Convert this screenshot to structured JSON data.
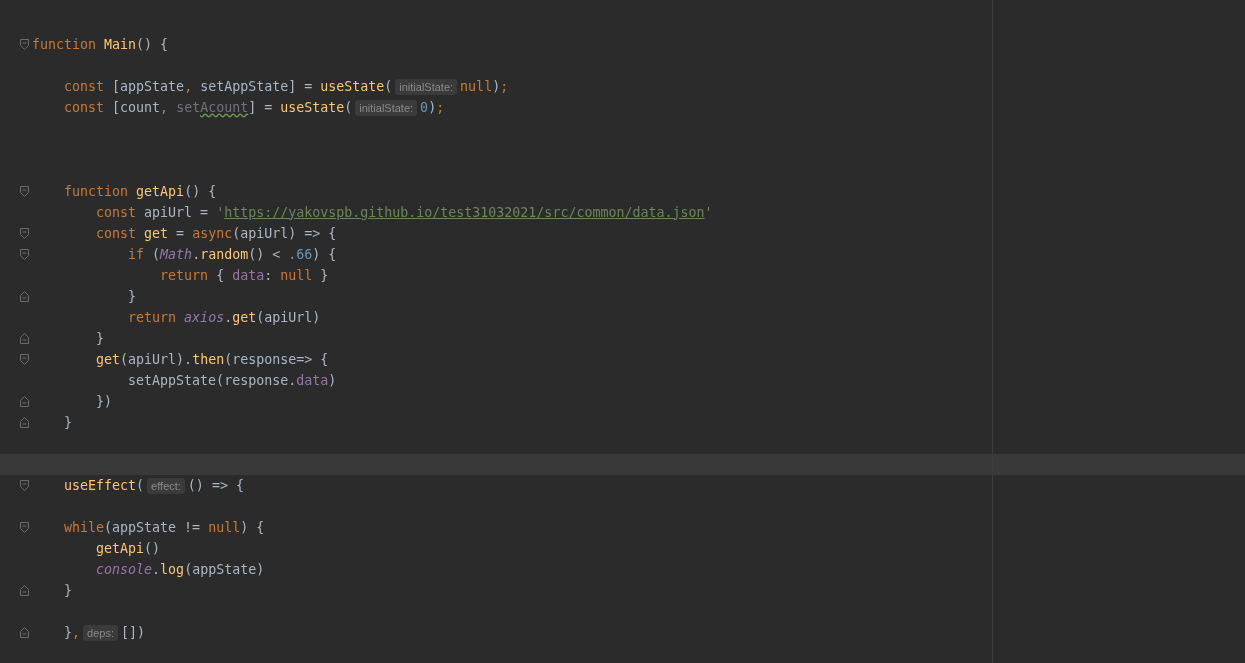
{
  "editor": {
    "lines": [
      {
        "kind": "fold_start",
        "tokens": [
          {
            "t": "function ",
            "kind": "kw"
          },
          {
            "t": "Main",
            "kind": "fn"
          },
          {
            "t": "() {",
            "kind": "p"
          }
        ]
      },
      {
        "kind": "plain"
      },
      {
        "kind": "plain",
        "tokens": [
          {
            "t": "    const",
            "kind": "kw"
          },
          {
            "t": " [appState",
            "kind": "p"
          },
          {
            "t": ",",
            "kind": "kw"
          },
          {
            "t": " setAppState] = ",
            "kind": "p"
          },
          {
            "t": "useState",
            "kind": "fn"
          },
          {
            "t": "(",
            "kind": "p"
          },
          {
            "t": "initialState:",
            "kind": "hint"
          },
          {
            "t": "null",
            "kind": "kw"
          },
          {
            "t": ")",
            "kind": "p"
          },
          {
            "t": ";",
            "kind": "kw"
          }
        ]
      },
      {
        "kind": "plain",
        "tokens": [
          {
            "t": "    const",
            "kind": "kw"
          },
          {
            "t": " [count",
            "kind": "p"
          },
          {
            "t": ",",
            "kind": "kw"
          },
          {
            "t": " set",
            "kind": "unused"
          },
          {
            "t": "Acount",
            "kind": "typo"
          },
          {
            "t": "] = ",
            "kind": "p"
          },
          {
            "t": "useState",
            "kind": "fn"
          },
          {
            "t": "(",
            "kind": "p"
          },
          {
            "t": "initialState:",
            "kind": "hint"
          },
          {
            "t": "0",
            "kind": "num"
          },
          {
            "t": ")",
            "kind": "p"
          },
          {
            "t": ";",
            "kind": "kw"
          }
        ]
      },
      {
        "kind": "plain"
      },
      {
        "kind": "plain"
      },
      {
        "kind": "plain"
      },
      {
        "kind": "fold_start",
        "tokens": [
          {
            "t": "    function ",
            "kind": "kw"
          },
          {
            "t": "getApi",
            "kind": "fn"
          },
          {
            "t": "() {",
            "kind": "p"
          }
        ]
      },
      {
        "kind": "plain",
        "tokens": [
          {
            "t": "        const",
            "kind": "kw"
          },
          {
            "t": " apiUrl = ",
            "kind": "p"
          },
          {
            "t": "'",
            "kind": "str"
          },
          {
            "t": "https://yakovspb.github.io/test31032021/src/common/data.json",
            "kind": "url"
          },
          {
            "t": "'",
            "kind": "str"
          }
        ]
      },
      {
        "kind": "fold_start",
        "tokens": [
          {
            "t": "        const ",
            "kind": "kw"
          },
          {
            "t": "get",
            "kind": "fn"
          },
          {
            "t": " = ",
            "kind": "p"
          },
          {
            "t": "async",
            "kind": "kw"
          },
          {
            "t": "(apiUrl) => {",
            "kind": "p"
          }
        ]
      },
      {
        "kind": "fold_start",
        "tokens": [
          {
            "t": "            if",
            "kind": "kw"
          },
          {
            "t": " (",
            "kind": "p"
          },
          {
            "t": "Math",
            "kind": "global"
          },
          {
            "t": ".random",
            "kind": "member_call"
          },
          {
            "t": "() < ",
            "kind": "p"
          },
          {
            "t": ".66",
            "kind": "num"
          },
          {
            "t": ") {",
            "kind": "p"
          }
        ]
      },
      {
        "kind": "plain",
        "tokens": [
          {
            "t": "                return",
            "kind": "kw"
          },
          {
            "t": " { ",
            "kind": "p"
          },
          {
            "t": "data",
            "kind": "member"
          },
          {
            "t": ": ",
            "kind": "p"
          },
          {
            "t": "null",
            "kind": "kw"
          },
          {
            "t": " }",
            "kind": "p"
          }
        ]
      },
      {
        "kind": "fold_end",
        "tokens": [
          {
            "t": "            }",
            "kind": "p"
          }
        ]
      },
      {
        "kind": "plain",
        "tokens": [
          {
            "t": "            return ",
            "kind": "kw"
          },
          {
            "t": "axios",
            "kind": "global"
          },
          {
            "t": ".get",
            "kind": "member_call"
          },
          {
            "t": "(apiUrl)",
            "kind": "p"
          }
        ]
      },
      {
        "kind": "fold_end",
        "tokens": [
          {
            "t": "        }",
            "kind": "p"
          }
        ]
      },
      {
        "kind": "fold_start",
        "tokens": [
          {
            "t": "        get",
            "kind": "fn"
          },
          {
            "t": "(apiUrl).",
            "kind": "p"
          },
          {
            "t": "then",
            "kind": "fn"
          },
          {
            "t": "(response=> {",
            "kind": "p"
          }
        ]
      },
      {
        "kind": "plain",
        "tokens": [
          {
            "t": "            setAppState(response.",
            "kind": "p"
          },
          {
            "t": "data",
            "kind": "member"
          },
          {
            "t": ")",
            "kind": "p"
          }
        ]
      },
      {
        "kind": "fold_end",
        "tokens": [
          {
            "t": "        })",
            "kind": "p"
          }
        ]
      },
      {
        "kind": "fold_end",
        "tokens": [
          {
            "t": "    }",
            "kind": "p"
          }
        ]
      },
      {
        "kind": "plain"
      },
      {
        "kind": "plain",
        "current": true
      },
      {
        "kind": "fold_start",
        "tokens": [
          {
            "t": "    useEffect",
            "kind": "fn"
          },
          {
            "t": "(",
            "kind": "p"
          },
          {
            "t": "effect:",
            "kind": "hint"
          },
          {
            "t": "() => {",
            "kind": "p"
          }
        ]
      },
      {
        "kind": "plain"
      },
      {
        "kind": "fold_start",
        "tokens": [
          {
            "t": "    while",
            "kind": "kw"
          },
          {
            "t": "(appState != ",
            "kind": "p"
          },
          {
            "t": "null",
            "kind": "kw"
          },
          {
            "t": ") {",
            "kind": "p"
          }
        ]
      },
      {
        "kind": "plain",
        "tokens": [
          {
            "t": "        getApi",
            "kind": "fn"
          },
          {
            "t": "()",
            "kind": "p"
          }
        ]
      },
      {
        "kind": "plain",
        "tokens": [
          {
            "t": "        console",
            "kind": "global"
          },
          {
            "t": ".log",
            "kind": "member_call"
          },
          {
            "t": "(appState)",
            "kind": "p"
          }
        ]
      },
      {
        "kind": "fold_end",
        "tokens": [
          {
            "t": "    }",
            "kind": "p"
          }
        ]
      },
      {
        "kind": "plain"
      },
      {
        "kind": "fold_end",
        "tokens": [
          {
            "t": "    }",
            "kind": "p"
          },
          {
            "t": ",",
            "kind": "kw"
          },
          {
            "t": "deps:",
            "kind": "hint"
          },
          {
            "t": "[])",
            "kind": "p"
          }
        ]
      }
    ]
  }
}
